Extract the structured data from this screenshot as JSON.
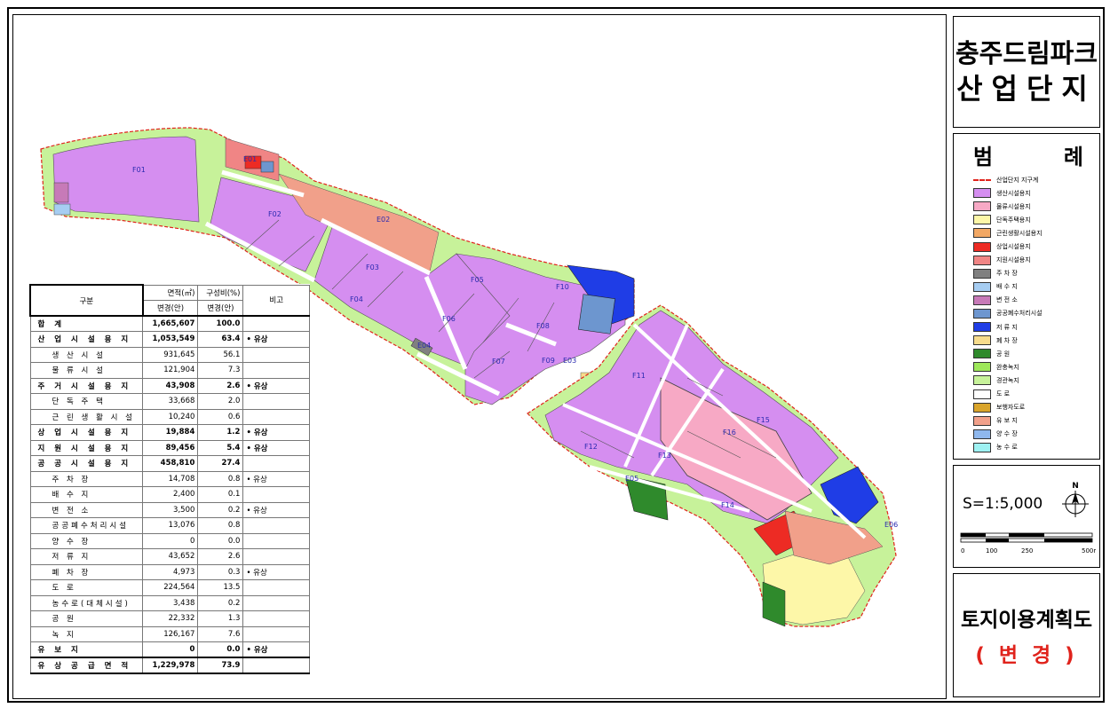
{
  "title": {
    "line1": "충주드림파크",
    "line2": "산업단지"
  },
  "legend": {
    "title_left": "범",
    "title_right": "례",
    "items": [
      {
        "label": "산업단지 지구계",
        "color": "#ffffff",
        "type": "boundary"
      },
      {
        "label": "생산시설용지",
        "color": "#d58ef0"
      },
      {
        "label": "물류시설용지",
        "color": "#f7a9c5"
      },
      {
        "label": "단독주택용지",
        "color": "#fdf7a8"
      },
      {
        "label": "근린생활시설용지",
        "color": "#f2a864"
      },
      {
        "label": "상업시설용지",
        "color": "#ed2b24"
      },
      {
        "label": "지원시설용지",
        "color": "#f08585"
      },
      {
        "label": "주 차 장",
        "color": "#808080"
      },
      {
        "label": "배 수 지",
        "color": "#a6cdf2"
      },
      {
        "label": "변 전 소",
        "color": "#c77ab8"
      },
      {
        "label": "공공폐수처리시설",
        "color": "#6d96cf"
      },
      {
        "label": "저 류 지",
        "color": "#1f3de6"
      },
      {
        "label": "폐 차 장",
        "color": "#f7dc8c"
      },
      {
        "label": "공 원",
        "color": "#2f8a2c"
      },
      {
        "label": "완충녹지",
        "color": "#9ee85a"
      },
      {
        "label": "경관녹지",
        "color": "#c7f29a"
      },
      {
        "label": "도 로",
        "color": "#ffffff"
      },
      {
        "label": "보행자도로",
        "color": "#d9a42a"
      },
      {
        "label": "유 보 지",
        "color": "#f1a08a"
      },
      {
        "label": "양 수 장",
        "color": "#8fb8ee"
      },
      {
        "label": "농 수 로",
        "color": "#9ef1f2"
      }
    ]
  },
  "scale": {
    "text": "S=1:5,000",
    "north": "N",
    "ticks": [
      "0",
      "100",
      "250",
      "500m"
    ]
  },
  "plan": {
    "title": "토지이용계획도",
    "subtitle": "( 변 경 )"
  },
  "table": {
    "header": {
      "category": "구분",
      "area": "면적(㎡)",
      "ratio": "구성비(%)",
      "note": "비고",
      "area_sub": "변경(안)",
      "ratio_sub": "변경(안)"
    },
    "rows": [
      {
        "name": "합 계",
        "area": "1,665,607",
        "ratio": "100.0",
        "note": "",
        "level": 0,
        "bold": true
      },
      {
        "name": "산 업 시 설 용 지",
        "area": "1,053,549",
        "ratio": "63.4",
        "note": "• 유상",
        "level": 0,
        "bold": true
      },
      {
        "name": "생 산 시 설",
        "area": "931,645",
        "ratio": "56.1",
        "note": "",
        "level": 1
      },
      {
        "name": "물 류 시 설",
        "area": "121,904",
        "ratio": "7.3",
        "note": "",
        "level": 1
      },
      {
        "name": "주 거 시 설 용 지",
        "area": "43,908",
        "ratio": "2.6",
        "note": "• 유상",
        "level": 0,
        "bold": true
      },
      {
        "name": "단 독 주 택",
        "area": "33,668",
        "ratio": "2.0",
        "note": "",
        "level": 1
      },
      {
        "name": "근 린 생 활 시 설",
        "area": "10,240",
        "ratio": "0.6",
        "note": "",
        "level": 1
      },
      {
        "name": "상 업 시 설 용 지",
        "area": "19,884",
        "ratio": "1.2",
        "note": "• 유상",
        "level": 0,
        "bold": true
      },
      {
        "name": "지 원 시 설 용 지",
        "area": "89,456",
        "ratio": "5.4",
        "note": "• 유상",
        "level": 0,
        "bold": true
      },
      {
        "name": "공 공 시 설 용 지",
        "area": "458,810",
        "ratio": "27.4",
        "note": "",
        "level": 0,
        "bold": true
      },
      {
        "name": "주 차 장",
        "area": "14,708",
        "ratio": "0.8",
        "note": "• 유상",
        "level": 1
      },
      {
        "name": "배 수 지",
        "area": "2,400",
        "ratio": "0.1",
        "note": "",
        "level": 1
      },
      {
        "name": "변 전 소",
        "area": "3,500",
        "ratio": "0.2",
        "note": "• 유상",
        "level": 1
      },
      {
        "name": "공공폐수처리시설",
        "area": "13,076",
        "ratio": "0.8",
        "note": "",
        "level": 1
      },
      {
        "name": "양 수 장",
        "area": "0",
        "ratio": "0.0",
        "note": "",
        "level": 1
      },
      {
        "name": "저 류 지",
        "area": "43,652",
        "ratio": "2.6",
        "note": "",
        "level": 1
      },
      {
        "name": "폐 차 장",
        "area": "4,973",
        "ratio": "0.3",
        "note": "• 유상",
        "level": 1
      },
      {
        "name": "도 로",
        "area": "224,564",
        "ratio": "13.5",
        "note": "",
        "level": 1
      },
      {
        "name": "농수로(대체시설)",
        "area": "3,438",
        "ratio": "0.2",
        "note": "",
        "level": 1
      },
      {
        "name": "공 원",
        "area": "22,332",
        "ratio": "1.3",
        "note": "",
        "level": 1
      },
      {
        "name": "녹 지",
        "area": "126,167",
        "ratio": "7.6",
        "note": "",
        "level": 1
      },
      {
        "name": "유 보 지",
        "area": "0",
        "ratio": "0.0",
        "note": "• 유상",
        "level": 0,
        "bold": true
      },
      {
        "name": "유 상 공 급 면 적",
        "area": "1,229,978",
        "ratio": "73.9",
        "note": "",
        "level": 0,
        "bold": true
      }
    ]
  },
  "map_labels": [
    "F01",
    "F02",
    "F03",
    "F04",
    "F05",
    "F06",
    "F07",
    "F08",
    "F09",
    "F10",
    "F11",
    "F12",
    "F13",
    "F14",
    "F15",
    "F16",
    "E01",
    "E02",
    "E03",
    "E04",
    "E05",
    "E06"
  ]
}
